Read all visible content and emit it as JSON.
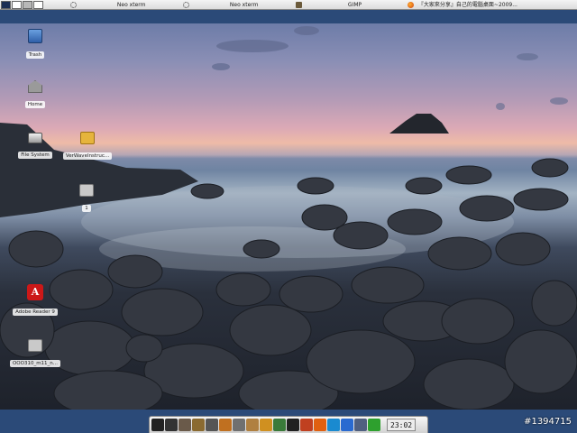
{
  "top_taskbar": {
    "pager_desktops": [
      "1",
      "2",
      "3",
      "4"
    ],
    "tasks": [
      {
        "icon": "gear-icon",
        "label": "Neo xterm"
      },
      {
        "icon": "gear-icon",
        "label": "Neo xterm"
      },
      {
        "icon": "gimp-icon",
        "label": "GIMP"
      },
      {
        "icon": "firefox-icon",
        "label": "『大家來分享』自己的電腦桌面~2009..."
      }
    ]
  },
  "desktop": {
    "icons": [
      {
        "name": "trash",
        "label": "Trash"
      },
      {
        "name": "home",
        "label": "Home"
      },
      {
        "name": "file-system",
        "label": "File System"
      },
      {
        "name": "verwave-folder",
        "label": "VerWaveInstruc..."
      },
      {
        "name": "folder-1",
        "label": "1"
      },
      {
        "name": "adobe-reader",
        "label": "Adobe Reader 9"
      },
      {
        "name": "ooo-folder",
        "label": "OOO310_m11_n..."
      }
    ]
  },
  "dock": {
    "items": [
      {
        "icon": "cat-icon",
        "color": "#222222"
      },
      {
        "icon": "terminal-icon",
        "color": "#333333"
      },
      {
        "icon": "photo-icon",
        "color": "#6a5a4a"
      },
      {
        "icon": "user-icon",
        "color": "#8a6a30"
      },
      {
        "icon": "settings-icon",
        "color": "#555555"
      },
      {
        "icon": "editor-icon",
        "color": "#c07020"
      },
      {
        "icon": "calculator-icon",
        "color": "#707070"
      },
      {
        "icon": "archive-icon",
        "color": "#b08040"
      },
      {
        "icon": "bird-icon",
        "color": "#d09020"
      },
      {
        "icon": "ve-icon",
        "color": "#3a7a3a"
      },
      {
        "icon": "penguin-icon",
        "color": "#202020"
      },
      {
        "icon": "paint-icon",
        "color": "#c04020"
      },
      {
        "icon": "firefox-icon",
        "color": "#e06010"
      },
      {
        "icon": "skype-icon",
        "color": "#1a8ad0"
      },
      {
        "icon": "chat-icon",
        "color": "#2a6ad0"
      },
      {
        "icon": "network-icon",
        "color": "#506080"
      },
      {
        "icon": "status-icon",
        "color": "#2ea02e"
      }
    ],
    "clock": "23:02"
  },
  "watermark": "#1394715",
  "colors": {
    "panel_background": "#2b4a78",
    "taskbar_background": "#e6e6e6"
  }
}
